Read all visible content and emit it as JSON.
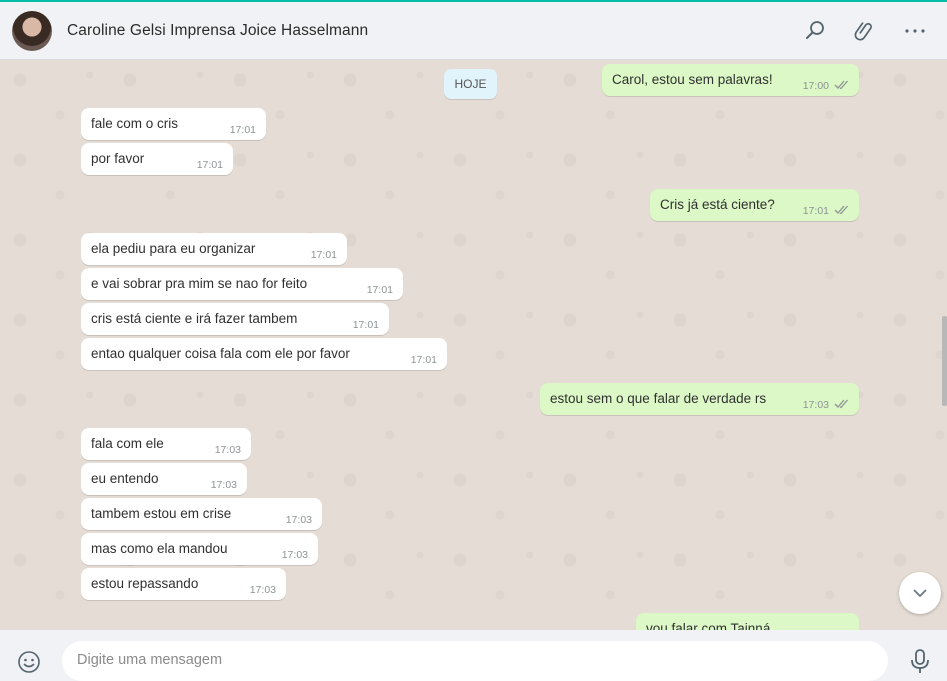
{
  "header": {
    "contact_name": "Caroline Gelsi Imprensa Joice Hasselmann",
    "icons": [
      "search-icon",
      "attach-icon",
      "menu-icon"
    ]
  },
  "chat": {
    "date_label": "HOJE",
    "messages": [
      {
        "dir": "out",
        "text": "Carol, estou sem palavras!",
        "time": "17:00",
        "status": "read"
      },
      {
        "dir": "in",
        "text": "fale com o cris",
        "time": "17:01"
      },
      {
        "dir": "in",
        "text": "por favor",
        "time": "17:01"
      },
      {
        "dir": "out",
        "text": "Cris já está ciente?",
        "time": "17:01",
        "status": "read"
      },
      {
        "dir": "in",
        "text": "ela pediu para eu organizar",
        "time": "17:01"
      },
      {
        "dir": "in",
        "text": "e vai sobrar pra mim se nao for feito",
        "time": "17:01"
      },
      {
        "dir": "in",
        "text": "cris está ciente e irá fazer tambem",
        "time": "17:01"
      },
      {
        "dir": "in",
        "text": "entao qualquer coisa fala com ele por favor",
        "time": "17:01"
      },
      {
        "dir": "out",
        "text": "estou sem o que falar de verdade rs",
        "time": "17:03",
        "status": "read"
      },
      {
        "dir": "in",
        "text": "fala com ele",
        "time": "17:03"
      },
      {
        "dir": "in",
        "text": "eu entendo",
        "time": "17:03"
      },
      {
        "dir": "in",
        "text": "tambem estou em crise",
        "time": "17:03"
      },
      {
        "dir": "in",
        "text": "mas como ela mandou",
        "time": "17:03"
      },
      {
        "dir": "in",
        "text": "estou repassando",
        "time": "17:03"
      },
      {
        "dir": "out",
        "text": "vou falar com Tainná",
        "time": "",
        "status": ""
      }
    ]
  },
  "composer": {
    "placeholder": "Digite uma mensagem",
    "icons": [
      "emoji-icon",
      "microphone-icon"
    ]
  },
  "colors": {
    "accent": "#00bfa5",
    "outgoing_bubble": "#dcf8c6",
    "incoming_bubble": "#ffffff",
    "read_ticks": "#4fc3f7"
  }
}
